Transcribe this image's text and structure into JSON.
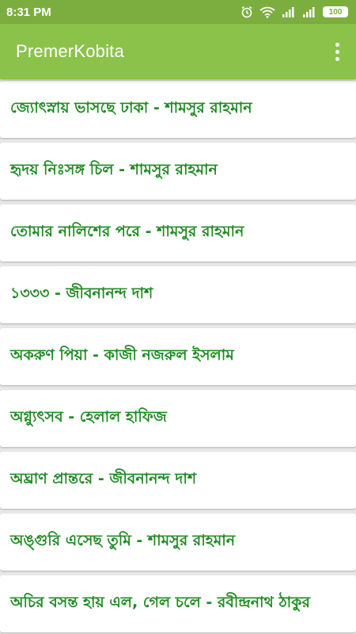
{
  "status_bar": {
    "time": "8:31 PM",
    "battery": "100",
    "icons": [
      "alarm-icon",
      "wifi-icon",
      "signal-icon",
      "signal-icon",
      "battery-icon"
    ]
  },
  "app_bar": {
    "title": "PremerKobita",
    "menu_icon": "more-vert-icon"
  },
  "colors": {
    "status_bar": "#7cae3f",
    "app_bar": "#8bc34a",
    "item_text": "#1f8a23",
    "background": "#e9e9e9"
  },
  "poems": [
    {
      "label": "জ্যোৎস্নায় ভাসছে ঢাকা - শামসুর রাহমান"
    },
    {
      "label": "হৃদয় নিঃসঙ্গ চিল - শামসুর রাহমান"
    },
    {
      "label": "তোমার নালিশের পরে - শামসুর রাহমান"
    },
    {
      "label": "১৩৩৩ - জীবনানন্দ দাশ"
    },
    {
      "label": "অকরুণ পিয়া - কাজী নজরুল ইসলাম"
    },
    {
      "label": "অগ্ন্যুৎসব - হেলাল হাফিজ"
    },
    {
      "label": "অঘ্রাণ প্রান্তরে - জীবনানন্দ দাশ"
    },
    {
      "label": "অঙ্গুরি এসেছ তুমি - শামসুর রাহমান"
    },
    {
      "label": "অচির বসন্ত হায় এল, গেল চলে - রবীন্দ্রনাথ ঠাকুর"
    }
  ]
}
